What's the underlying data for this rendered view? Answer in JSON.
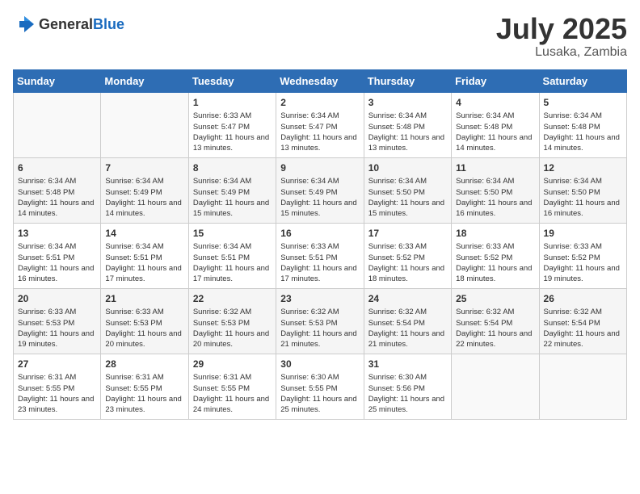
{
  "logo": {
    "general": "General",
    "blue": "Blue"
  },
  "header": {
    "month": "July 2025",
    "location": "Lusaka, Zambia"
  },
  "weekdays": [
    "Sunday",
    "Monday",
    "Tuesday",
    "Wednesday",
    "Thursday",
    "Friday",
    "Saturday"
  ],
  "weeks": [
    [
      {
        "day": "",
        "sunrise": "",
        "sunset": "",
        "daylight": ""
      },
      {
        "day": "",
        "sunrise": "",
        "sunset": "",
        "daylight": ""
      },
      {
        "day": "1",
        "sunrise": "Sunrise: 6:33 AM",
        "sunset": "Sunset: 5:47 PM",
        "daylight": "Daylight: 11 hours and 13 minutes."
      },
      {
        "day": "2",
        "sunrise": "Sunrise: 6:34 AM",
        "sunset": "Sunset: 5:47 PM",
        "daylight": "Daylight: 11 hours and 13 minutes."
      },
      {
        "day": "3",
        "sunrise": "Sunrise: 6:34 AM",
        "sunset": "Sunset: 5:48 PM",
        "daylight": "Daylight: 11 hours and 13 minutes."
      },
      {
        "day": "4",
        "sunrise": "Sunrise: 6:34 AM",
        "sunset": "Sunset: 5:48 PM",
        "daylight": "Daylight: 11 hours and 14 minutes."
      },
      {
        "day": "5",
        "sunrise": "Sunrise: 6:34 AM",
        "sunset": "Sunset: 5:48 PM",
        "daylight": "Daylight: 11 hours and 14 minutes."
      }
    ],
    [
      {
        "day": "6",
        "sunrise": "Sunrise: 6:34 AM",
        "sunset": "Sunset: 5:48 PM",
        "daylight": "Daylight: 11 hours and 14 minutes."
      },
      {
        "day": "7",
        "sunrise": "Sunrise: 6:34 AM",
        "sunset": "Sunset: 5:49 PM",
        "daylight": "Daylight: 11 hours and 14 minutes."
      },
      {
        "day": "8",
        "sunrise": "Sunrise: 6:34 AM",
        "sunset": "Sunset: 5:49 PM",
        "daylight": "Daylight: 11 hours and 15 minutes."
      },
      {
        "day": "9",
        "sunrise": "Sunrise: 6:34 AM",
        "sunset": "Sunset: 5:49 PM",
        "daylight": "Daylight: 11 hours and 15 minutes."
      },
      {
        "day": "10",
        "sunrise": "Sunrise: 6:34 AM",
        "sunset": "Sunset: 5:50 PM",
        "daylight": "Daylight: 11 hours and 15 minutes."
      },
      {
        "day": "11",
        "sunrise": "Sunrise: 6:34 AM",
        "sunset": "Sunset: 5:50 PM",
        "daylight": "Daylight: 11 hours and 16 minutes."
      },
      {
        "day": "12",
        "sunrise": "Sunrise: 6:34 AM",
        "sunset": "Sunset: 5:50 PM",
        "daylight": "Daylight: 11 hours and 16 minutes."
      }
    ],
    [
      {
        "day": "13",
        "sunrise": "Sunrise: 6:34 AM",
        "sunset": "Sunset: 5:51 PM",
        "daylight": "Daylight: 11 hours and 16 minutes."
      },
      {
        "day": "14",
        "sunrise": "Sunrise: 6:34 AM",
        "sunset": "Sunset: 5:51 PM",
        "daylight": "Daylight: 11 hours and 17 minutes."
      },
      {
        "day": "15",
        "sunrise": "Sunrise: 6:34 AM",
        "sunset": "Sunset: 5:51 PM",
        "daylight": "Daylight: 11 hours and 17 minutes."
      },
      {
        "day": "16",
        "sunrise": "Sunrise: 6:33 AM",
        "sunset": "Sunset: 5:51 PM",
        "daylight": "Daylight: 11 hours and 17 minutes."
      },
      {
        "day": "17",
        "sunrise": "Sunrise: 6:33 AM",
        "sunset": "Sunset: 5:52 PM",
        "daylight": "Daylight: 11 hours and 18 minutes."
      },
      {
        "day": "18",
        "sunrise": "Sunrise: 6:33 AM",
        "sunset": "Sunset: 5:52 PM",
        "daylight": "Daylight: 11 hours and 18 minutes."
      },
      {
        "day": "19",
        "sunrise": "Sunrise: 6:33 AM",
        "sunset": "Sunset: 5:52 PM",
        "daylight": "Daylight: 11 hours and 19 minutes."
      }
    ],
    [
      {
        "day": "20",
        "sunrise": "Sunrise: 6:33 AM",
        "sunset": "Sunset: 5:53 PM",
        "daylight": "Daylight: 11 hours and 19 minutes."
      },
      {
        "day": "21",
        "sunrise": "Sunrise: 6:33 AM",
        "sunset": "Sunset: 5:53 PM",
        "daylight": "Daylight: 11 hours and 20 minutes."
      },
      {
        "day": "22",
        "sunrise": "Sunrise: 6:32 AM",
        "sunset": "Sunset: 5:53 PM",
        "daylight": "Daylight: 11 hours and 20 minutes."
      },
      {
        "day": "23",
        "sunrise": "Sunrise: 6:32 AM",
        "sunset": "Sunset: 5:53 PM",
        "daylight": "Daylight: 11 hours and 21 minutes."
      },
      {
        "day": "24",
        "sunrise": "Sunrise: 6:32 AM",
        "sunset": "Sunset: 5:54 PM",
        "daylight": "Daylight: 11 hours and 21 minutes."
      },
      {
        "day": "25",
        "sunrise": "Sunrise: 6:32 AM",
        "sunset": "Sunset: 5:54 PM",
        "daylight": "Daylight: 11 hours and 22 minutes."
      },
      {
        "day": "26",
        "sunrise": "Sunrise: 6:32 AM",
        "sunset": "Sunset: 5:54 PM",
        "daylight": "Daylight: 11 hours and 22 minutes."
      }
    ],
    [
      {
        "day": "27",
        "sunrise": "Sunrise: 6:31 AM",
        "sunset": "Sunset: 5:55 PM",
        "daylight": "Daylight: 11 hours and 23 minutes."
      },
      {
        "day": "28",
        "sunrise": "Sunrise: 6:31 AM",
        "sunset": "Sunset: 5:55 PM",
        "daylight": "Daylight: 11 hours and 23 minutes."
      },
      {
        "day": "29",
        "sunrise": "Sunrise: 6:31 AM",
        "sunset": "Sunset: 5:55 PM",
        "daylight": "Daylight: 11 hours and 24 minutes."
      },
      {
        "day": "30",
        "sunrise": "Sunrise: 6:30 AM",
        "sunset": "Sunset: 5:55 PM",
        "daylight": "Daylight: 11 hours and 25 minutes."
      },
      {
        "day": "31",
        "sunrise": "Sunrise: 6:30 AM",
        "sunset": "Sunset: 5:56 PM",
        "daylight": "Daylight: 11 hours and 25 minutes."
      },
      {
        "day": "",
        "sunrise": "",
        "sunset": "",
        "daylight": ""
      },
      {
        "day": "",
        "sunrise": "",
        "sunset": "",
        "daylight": ""
      }
    ]
  ]
}
